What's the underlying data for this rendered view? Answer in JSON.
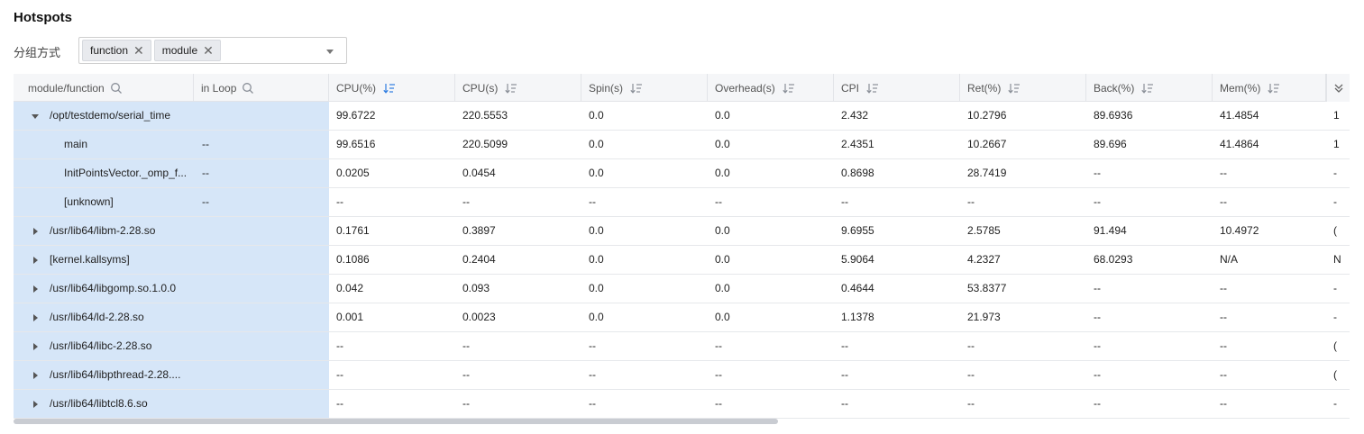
{
  "page": {
    "title": "Hotspots",
    "group_label": "分组方式",
    "group_tags": [
      "function",
      "module"
    ]
  },
  "table": {
    "columns": [
      {
        "label": "module/function",
        "kind": "search"
      },
      {
        "label": "in Loop",
        "kind": "search"
      },
      {
        "label": "CPU(%)",
        "kind": "sort",
        "active": true
      },
      {
        "label": "CPU(s)",
        "kind": "sort"
      },
      {
        "label": "Spin(s)",
        "kind": "sort"
      },
      {
        "label": "Overhead(s)",
        "kind": "sort"
      },
      {
        "label": "CPI",
        "kind": "sort"
      },
      {
        "label": "Ret(%)",
        "kind": "sort"
      },
      {
        "label": "Back(%)",
        "kind": "sort"
      },
      {
        "label": "Mem(%)",
        "kind": "sort"
      },
      {
        "label": "",
        "kind": "none"
      }
    ],
    "rows": [
      {
        "name": "/opt/testdemo/serial_time",
        "level": 0,
        "expander": "down",
        "loop": "",
        "values": [
          "99.6722",
          "220.5553",
          "0.0",
          "0.0",
          "2.432",
          "10.2796",
          "89.6936",
          "41.4854",
          "1"
        ]
      },
      {
        "name": "main",
        "level": 1,
        "expander": "none",
        "loop": "--",
        "values": [
          "99.6516",
          "220.5099",
          "0.0",
          "0.0",
          "2.4351",
          "10.2667",
          "89.696",
          "41.4864",
          "1"
        ]
      },
      {
        "name": "InitPointsVector._omp_f...",
        "level": 1,
        "expander": "none",
        "loop": "--",
        "values": [
          "0.0205",
          "0.0454",
          "0.0",
          "0.0",
          "0.8698",
          "28.7419",
          "--",
          "--",
          "-"
        ]
      },
      {
        "name": "[unknown]",
        "level": 1,
        "expander": "none",
        "loop": "--",
        "values": [
          "--",
          "--",
          "--",
          "--",
          "--",
          "--",
          "--",
          "--",
          "-"
        ]
      },
      {
        "name": "/usr/lib64/libm-2.28.so",
        "level": 0,
        "expander": "right",
        "loop": "",
        "values": [
          "0.1761",
          "0.3897",
          "0.0",
          "0.0",
          "9.6955",
          "2.5785",
          "91.494",
          "10.4972",
          "("
        ]
      },
      {
        "name": "[kernel.kallsyms]",
        "level": 0,
        "expander": "right",
        "loop": "",
        "values": [
          "0.1086",
          "0.2404",
          "0.0",
          "0.0",
          "5.9064",
          "4.2327",
          "68.0293",
          "N/A",
          "N"
        ]
      },
      {
        "name": "/usr/lib64/libgomp.so.1.0.0",
        "level": 0,
        "expander": "right",
        "loop": "",
        "values": [
          "0.042",
          "0.093",
          "0.0",
          "0.0",
          "0.4644",
          "53.8377",
          "--",
          "--",
          "-"
        ]
      },
      {
        "name": "/usr/lib64/ld-2.28.so",
        "level": 0,
        "expander": "right",
        "loop": "",
        "values": [
          "0.001",
          "0.0023",
          "0.0",
          "0.0",
          "1.1378",
          "21.973",
          "--",
          "--",
          "-"
        ]
      },
      {
        "name": "/usr/lib64/libc-2.28.so",
        "level": 0,
        "expander": "right",
        "loop": "",
        "values": [
          "--",
          "--",
          "--",
          "--",
          "--",
          "--",
          "--",
          "--",
          "("
        ]
      },
      {
        "name": "/usr/lib64/libpthread-2.28....",
        "level": 0,
        "expander": "right",
        "loop": "",
        "values": [
          "--",
          "--",
          "--",
          "--",
          "--",
          "--",
          "--",
          "--",
          "("
        ]
      },
      {
        "name": "/usr/lib64/libtcl8.6.so",
        "level": 0,
        "expander": "right",
        "loop": "",
        "values": [
          "--",
          "--",
          "--",
          "--",
          "--",
          "--",
          "--",
          "--",
          "-"
        ]
      }
    ]
  },
  "colors": {
    "function_column_bg": "#d6e6f8",
    "sort_active": "#2f7de1",
    "sort_inactive": "#8a8f98"
  }
}
